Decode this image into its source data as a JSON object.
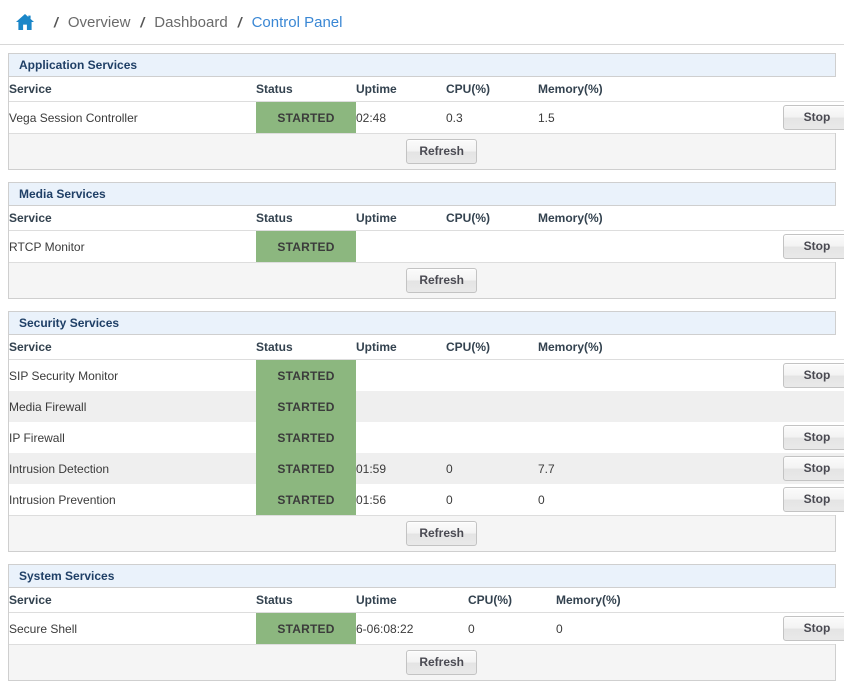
{
  "breadcrumb": {
    "home_icon": "home-icon",
    "separator": "/",
    "items": [
      {
        "label": "Overview",
        "active": false
      },
      {
        "label": "Dashboard",
        "active": false
      },
      {
        "label": "Control Panel",
        "active": true
      }
    ]
  },
  "columns": {
    "service": "Service",
    "status": "Status",
    "uptime": "Uptime",
    "cpu": "CPU(%)",
    "memory": "Memory(%)"
  },
  "labels": {
    "refresh": "Refresh",
    "stop": "Stop",
    "status_started": "STARTED"
  },
  "colors": {
    "status_started_bg": "#8cb77f",
    "panel_header_bg": "#eaf2fb",
    "panel_title_text": "#1f3f66",
    "breadcrumb_link": "#3a87d4",
    "row_stripe": "#efefef"
  },
  "panels": [
    {
      "title": "Application Services",
      "rows": [
        {
          "service": "Vega Session Controller",
          "status": "STARTED",
          "uptime": "02:48",
          "cpu": "0.3",
          "memory": "1.5",
          "action": "Stop"
        }
      ],
      "footer_button": "Refresh"
    },
    {
      "title": "Media Services",
      "rows": [
        {
          "service": "RTCP Monitor",
          "status": "STARTED",
          "uptime": "",
          "cpu": "",
          "memory": "",
          "action": "Stop"
        }
      ],
      "footer_button": "Refresh"
    },
    {
      "title": "Security Services",
      "rows": [
        {
          "service": "SIP Security Monitor",
          "status": "STARTED",
          "uptime": "",
          "cpu": "",
          "memory": "",
          "action": "Stop"
        },
        {
          "service": "Media Firewall",
          "status": "STARTED",
          "uptime": "",
          "cpu": "",
          "memory": "",
          "action": ""
        },
        {
          "service": "IP Firewall",
          "status": "STARTED",
          "uptime": "",
          "cpu": "",
          "memory": "",
          "action": "Stop"
        },
        {
          "service": "Intrusion Detection",
          "status": "STARTED",
          "uptime": "01:59",
          "cpu": "0",
          "memory": "7.7",
          "action": "Stop"
        },
        {
          "service": "Intrusion Prevention",
          "status": "STARTED",
          "uptime": "01:56",
          "cpu": "0",
          "memory": "0",
          "action": "Stop"
        }
      ],
      "footer_button": "Refresh"
    },
    {
      "title": "System Services",
      "rows": [
        {
          "service": "Secure Shell",
          "status": "STARTED",
          "uptime": "6-06:08:22",
          "cpu": "0",
          "memory": "0",
          "action": "Stop"
        }
      ],
      "footer_button": "Refresh"
    }
  ]
}
